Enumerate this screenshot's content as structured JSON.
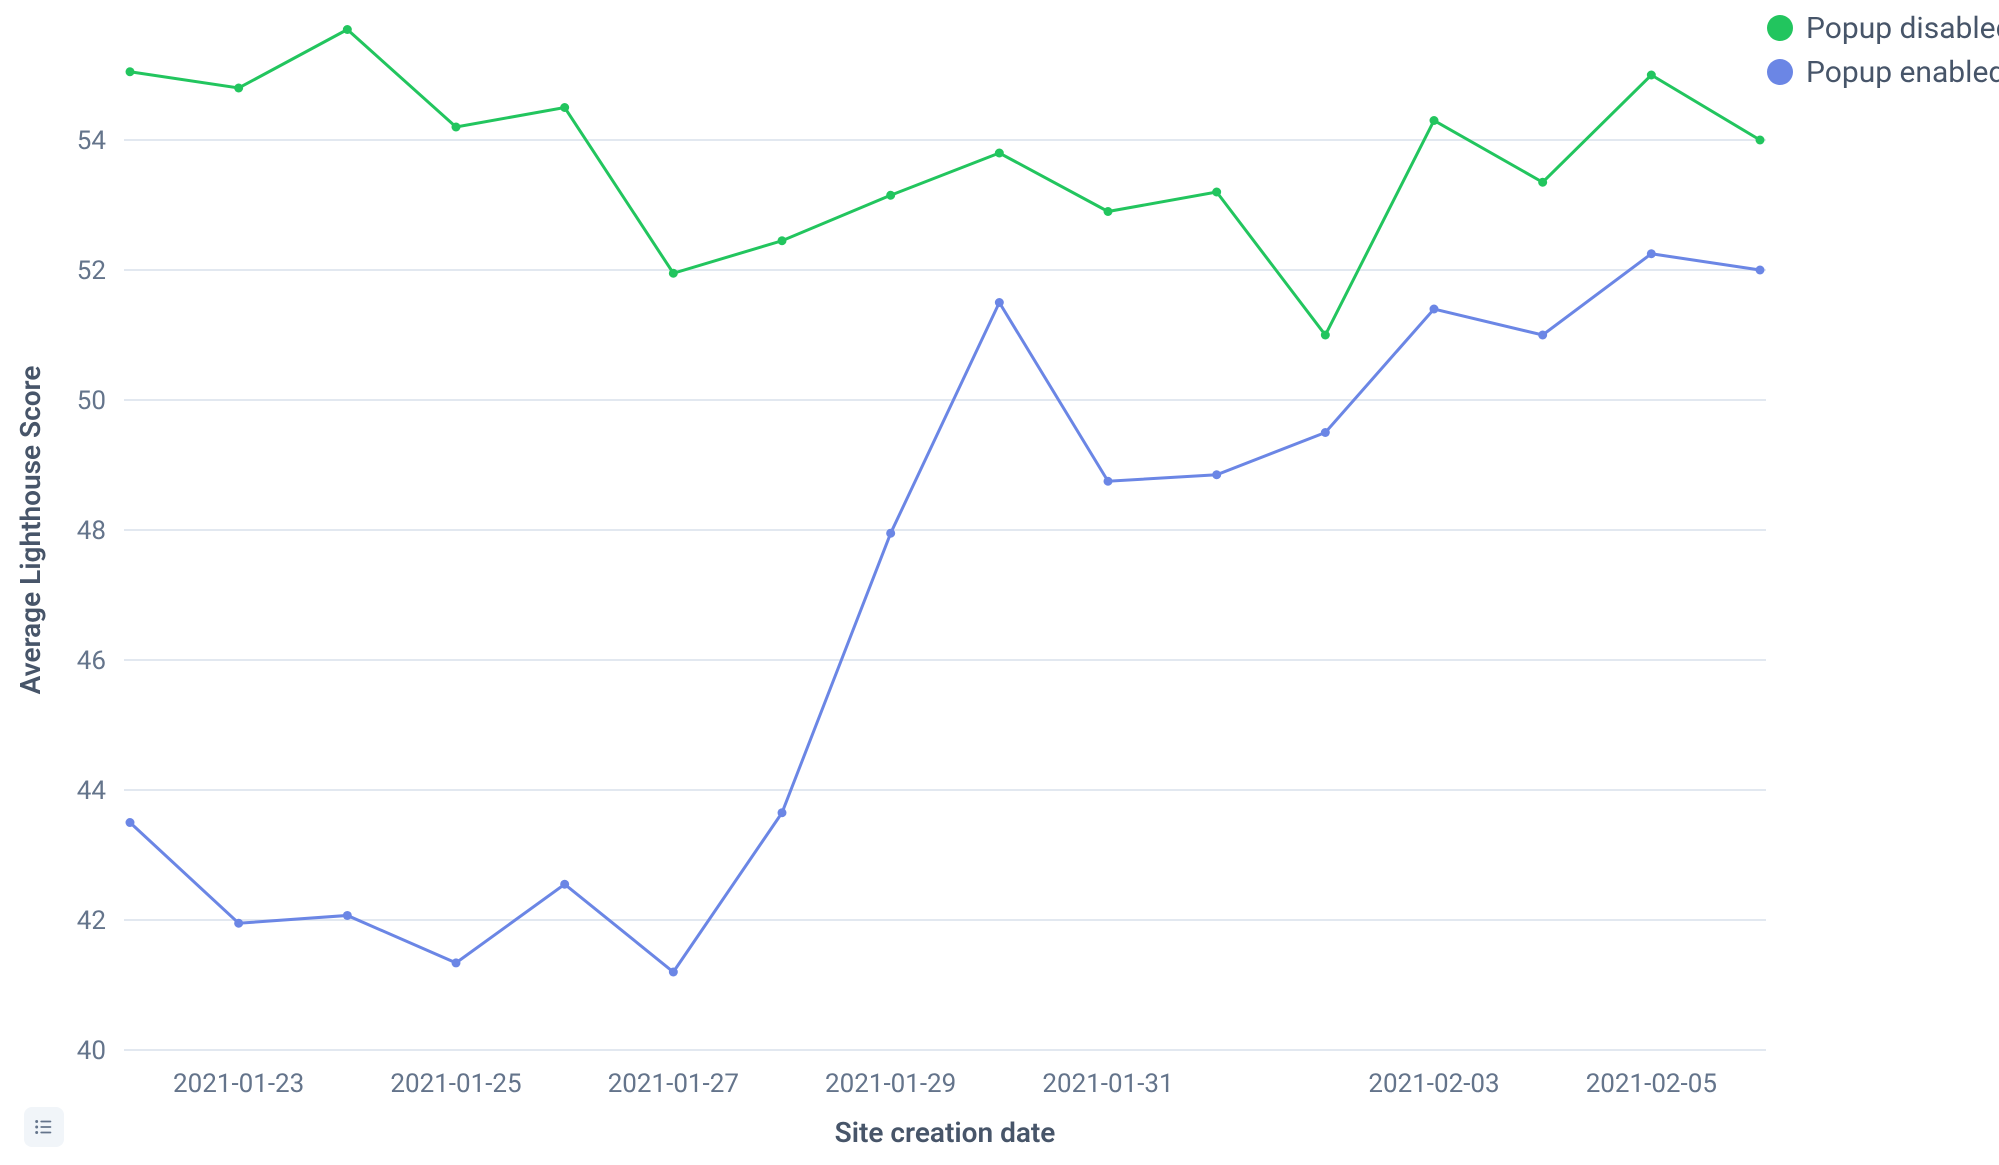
{
  "chart_data": {
    "type": "line",
    "xlabel": "Site creation date",
    "ylabel": "Average Lighthouse Score",
    "ylim": [
      40,
      56
    ],
    "y_ticks": [
      40,
      42,
      44,
      46,
      48,
      50,
      52,
      54
    ],
    "x_ticks": [
      "2021-01-23",
      "2021-01-25",
      "2021-01-27",
      "2021-01-29",
      "2021-01-31",
      "2021-02-03",
      "2021-02-05"
    ],
    "x_tick_indices": [
      1,
      3,
      5,
      7,
      9,
      12,
      14
    ],
    "categories": [
      "2021-01-22",
      "2021-01-23",
      "2021-01-24",
      "2021-01-25",
      "2021-01-26",
      "2021-01-27",
      "2021-01-28",
      "2021-01-29",
      "2021-01-30",
      "2021-01-31",
      "2021-02-01",
      "2021-02-02",
      "2021-02-03",
      "2021-02-04",
      "2021-02-05",
      "2021-02-06"
    ],
    "series": [
      {
        "name": "Popup disabled",
        "color": "#22c55e",
        "values": [
          55.05,
          54.8,
          55.7,
          54.2,
          54.5,
          51.95,
          52.45,
          53.15,
          53.8,
          52.9,
          53.2,
          51.0,
          54.3,
          53.35,
          55.0,
          54.0
        ]
      },
      {
        "name": "Popup enabled",
        "color": "#6b86e5",
        "values": [
          43.5,
          41.95,
          42.07,
          41.34,
          42.55,
          41.2,
          43.65,
          47.95,
          51.5,
          48.75,
          48.85,
          49.5,
          51.4,
          51.0,
          52.25,
          52.0
        ]
      }
    ],
    "legend_position": "top-right"
  },
  "legend": {
    "items": [
      {
        "label": "Popup disabled"
      },
      {
        "label": "Popup enabled"
      }
    ]
  },
  "controls": {
    "legend_button_name": "legend-toggle"
  }
}
